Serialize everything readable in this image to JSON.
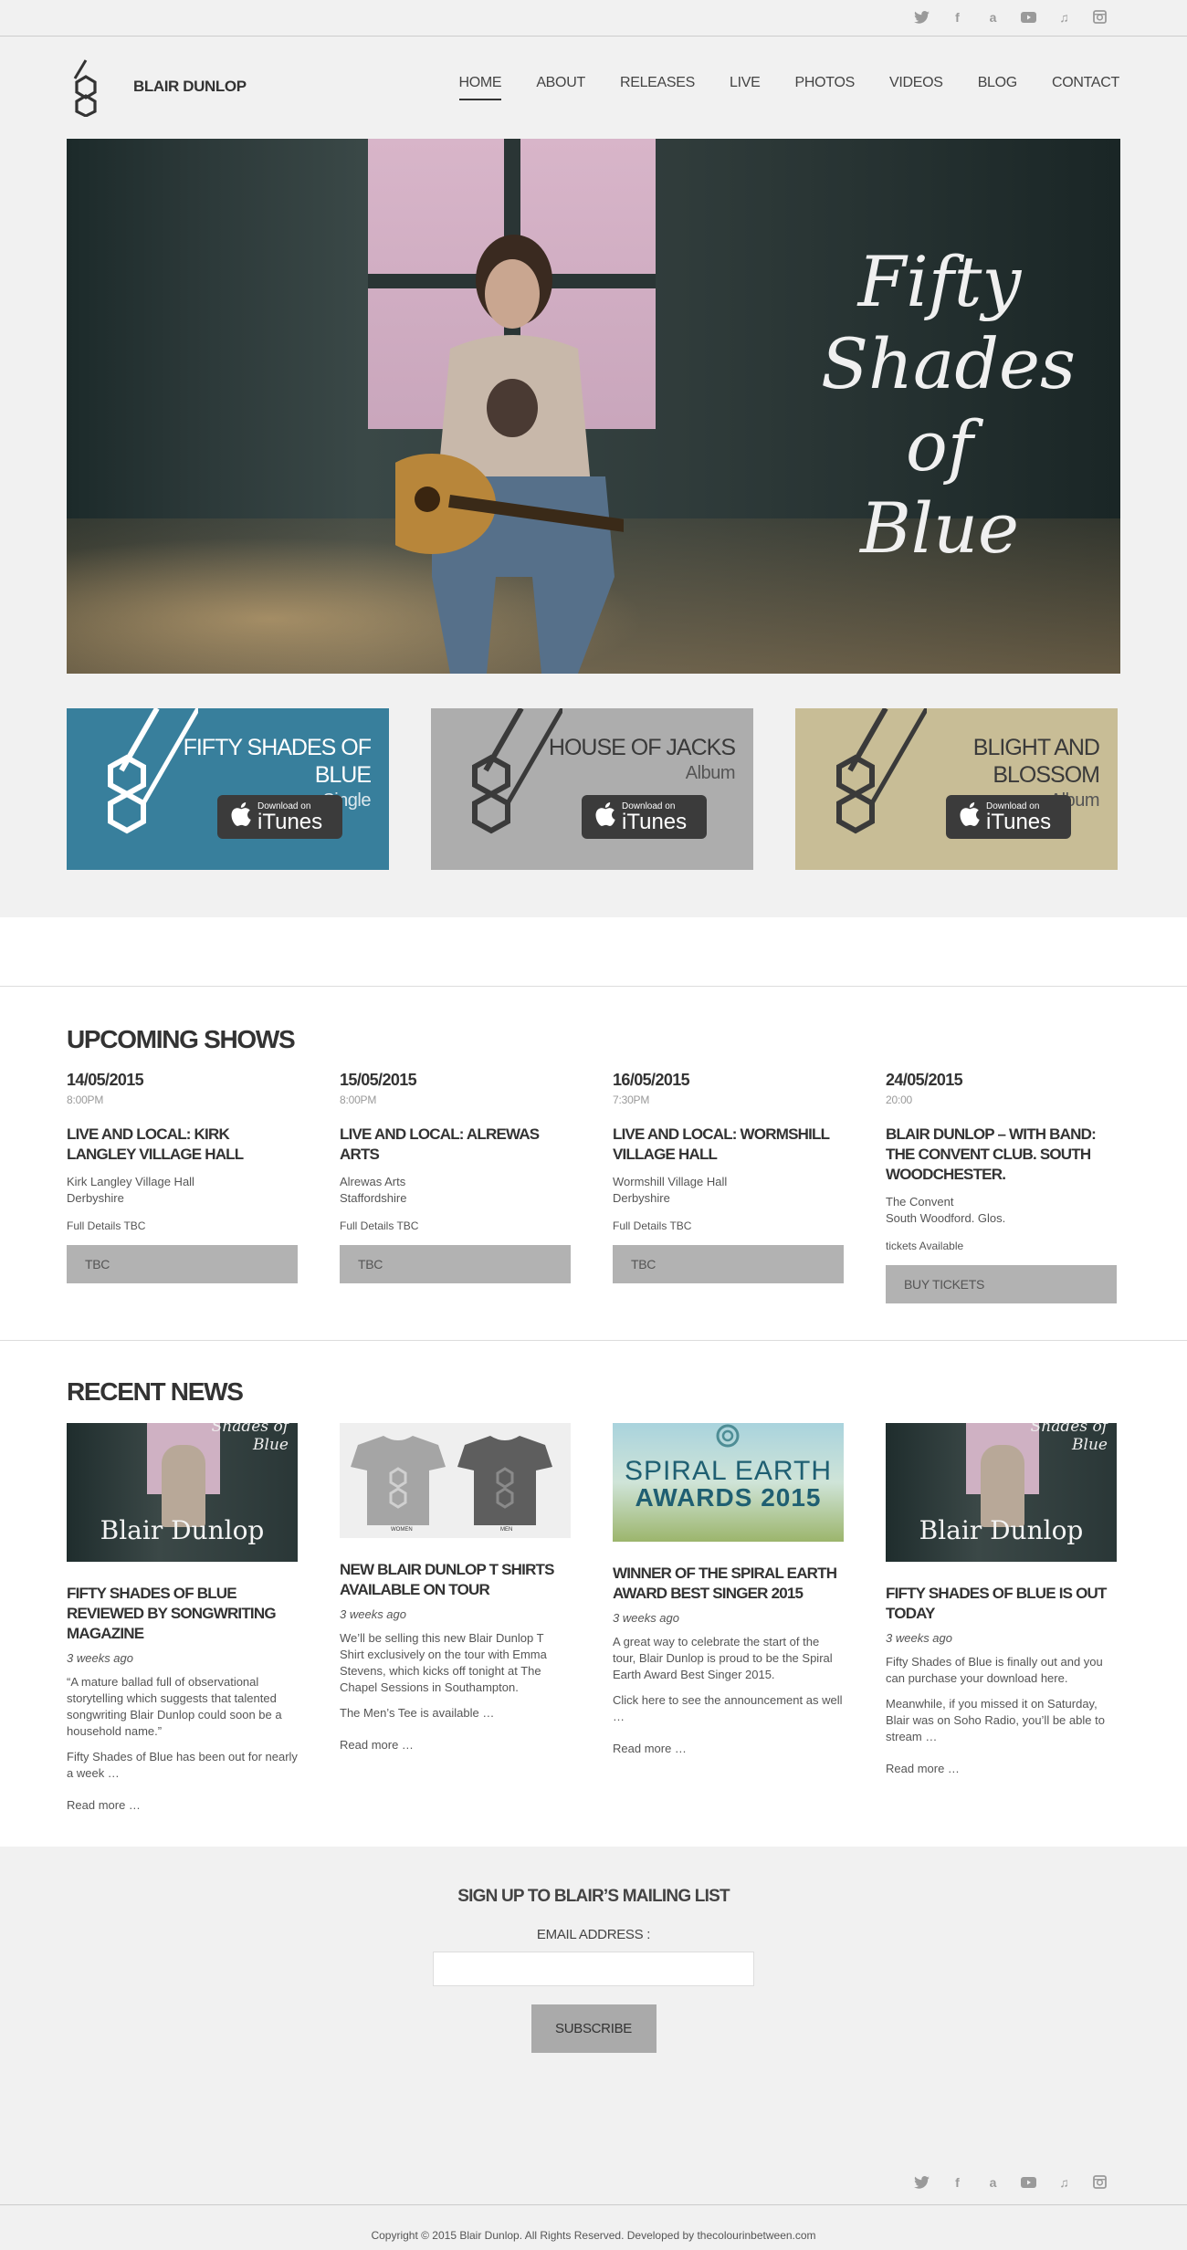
{
  "social": [
    "twitter-icon",
    "facebook-icon",
    "amazon-icon",
    "youtube-icon",
    "music-icon",
    "instagram-icon"
  ],
  "header": {
    "site_name": "BLAIR DUNLOP",
    "nav": [
      "HOME",
      "ABOUT",
      "RELEASES",
      "LIVE",
      "PHOTOS",
      "VIDEOS",
      "BLOG",
      "CONTACT"
    ],
    "active": "HOME"
  },
  "hero": {
    "title_line1": "Fifty",
    "title_line2": "Shades",
    "title_line3": "of Blue"
  },
  "releases": [
    {
      "title": "FIFTY SHADES OF BLUE",
      "type": "Single",
      "bg": "#387f9c",
      "text_color": "#ffffff",
      "itunes_small": "Download on",
      "itunes_big": "iTunes"
    },
    {
      "title": "HOUSE OF JACKS",
      "type": "Album",
      "bg": "#adadad",
      "text_color": "#3a3a3a",
      "itunes_small": "Download on",
      "itunes_big": "iTunes"
    },
    {
      "title": "BLIGHT AND BLOSSOM",
      "type": "Album",
      "bg": "#c8bd96",
      "text_color": "#3a3a3a",
      "itunes_small": "Download on",
      "itunes_big": "iTunes"
    }
  ],
  "shows": {
    "heading": "UPCOMING SHOWS",
    "items": [
      {
        "date": "14/05/2015",
        "time": "8:00PM",
        "title": "LIVE AND LOCAL: KIRK LANGLEY VILLAGE HALL",
        "venue1": "Kirk Langley Village Hall",
        "venue2": "Derbyshire",
        "details": "Full Details TBC",
        "button": "TBC"
      },
      {
        "date": "15/05/2015",
        "time": "8:00PM",
        "title": "LIVE AND LOCAL: ALREWAS ARTS",
        "venue1": "Alrewas Arts",
        "venue2": "Staffordshire",
        "details": "Full Details TBC",
        "button": "TBC"
      },
      {
        "date": "16/05/2015",
        "time": "7:30PM",
        "title": "LIVE AND LOCAL: WORMSHILL VILLAGE HALL",
        "venue1": "Wormshill Village Hall",
        "venue2": "Derbyshire",
        "details": "Full Details TBC",
        "button": "TBC"
      },
      {
        "date": "24/05/2015",
        "time": "20:00",
        "title": "BLAIR DUNLOP – WITH BAND: THE CONVENT CLUB. SOUTH WOODCHESTER.",
        "venue1": "The Convent",
        "venue2": "South Woodford. Glos.",
        "details": "tickets Available",
        "button": "BUY TICKETS"
      }
    ]
  },
  "news": {
    "heading": "RECENT NEWS",
    "items": [
      {
        "thumb_text": "Blair Dunlop",
        "thumb_sub": "Shades of Blue",
        "title": "FIFTY SHADES OF BLUE REVIEWED BY SONGWRITING MAGAZINE",
        "ago": "3 weeks ago",
        "p1": "“A mature ballad full of observational storytelling which suggests that talented songwriting Blair Dunlop could soon be a household name.”",
        "p2": "Fifty Shades of Blue has been out for nearly a week …",
        "more": "Read more …"
      },
      {
        "thumb_women": "WOMEN",
        "thumb_men": "MEN",
        "title": "NEW BLAIR DUNLOP T SHIRTS AVAILABLE ON TOUR",
        "ago": "3 weeks ago",
        "p1": "We’ll be selling this new Blair Dunlop T Shirt exclusively on the tour with Emma Stevens, which kicks off tonight at The Chapel Sessions in Southampton.",
        "p2": "The Men’s Tee is available …",
        "more": "Read more …"
      },
      {
        "thumb_line1": "SPIRAL EARTH",
        "thumb_line2": "AWARDS 2015",
        "title": "WINNER OF THE SPIRAL EARTH AWARD BEST SINGER 2015",
        "ago": "3 weeks ago",
        "p1": "A great way to celebrate the start of the tour, Blair Dunlop is proud to be the Spiral Earth Award Best Singer 2015.",
        "p2": "Click here to see the announcement as well …",
        "more": "Read more …"
      },
      {
        "thumb_text": "Blair Dunlop",
        "thumb_sub": "Shades of Blue",
        "title": "FIFTY SHADES OF BLUE IS OUT TODAY",
        "ago": "3 weeks ago",
        "p1": "Fifty Shades of Blue is finally out and you can purchase your download here.",
        "p2": "Meanwhile, if you missed it on Saturday, Blair was on Soho Radio, you’ll be able to stream …",
        "more": "Read more …"
      }
    ]
  },
  "signup": {
    "heading": "SIGN UP TO BLAIR’S MAILING LIST",
    "label": "EMAIL ADDRESS :",
    "email_value": "",
    "button": "SUBSCRIBE"
  },
  "footer": {
    "copyright": "Copyright © 2015 Blair Dunlop. All Rights Reserved. Developed by thecolourinbetween.com"
  }
}
